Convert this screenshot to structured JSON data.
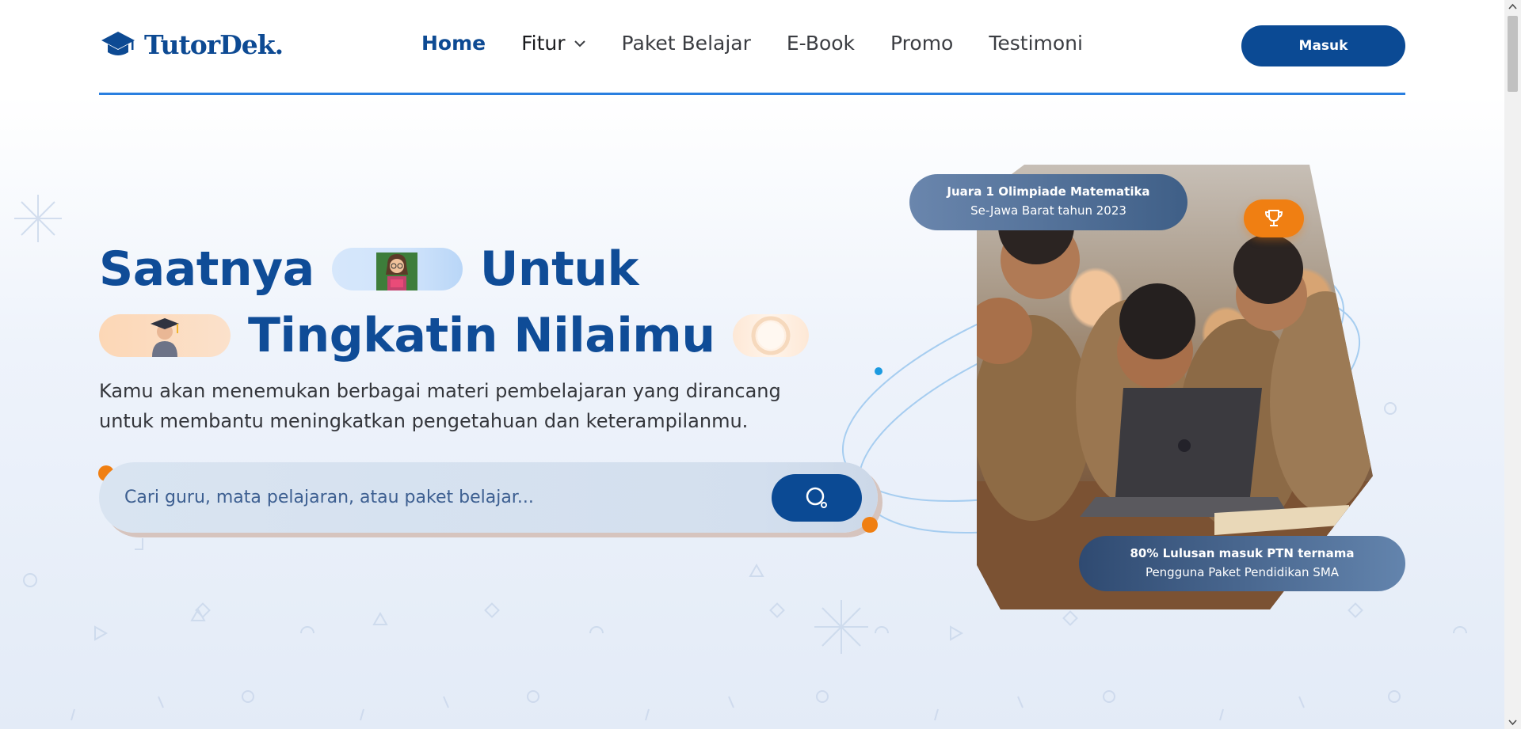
{
  "brand": {
    "name": "TutorDek.",
    "color": "#0d4a93"
  },
  "nav": {
    "items": [
      {
        "label": "Home",
        "state": "active"
      },
      {
        "label": "Fitur",
        "state": "dropdown"
      },
      {
        "label": "Paket Belajar"
      },
      {
        "label": "E-Book"
      },
      {
        "label": "Promo"
      },
      {
        "label": "Testimoni"
      }
    ],
    "login_label": "Masuk"
  },
  "hero": {
    "headline_line1_a": "Saatnya",
    "headline_line1_b": "Untuk",
    "headline_line2": "Tingkatin Nilaimu",
    "lead": "Kamu akan menemukan berbagai materi pembelajaran yang dirancang untuk membantu meningkatkan pengetahuan dan keterampilanmu.",
    "search_placeholder": "Cari guru, mata pelajaran, atau paket belajar...",
    "search_icon": "search-icon"
  },
  "badges": {
    "top": {
      "title": "Juara 1 Olimpiade Matematika",
      "sub": "Se-Jawa Barat tahun 2023"
    },
    "bottom": {
      "title": "80% Lulusan masuk PTN ternama",
      "sub": "Pengguna Paket Pendidikan SMA"
    },
    "trophy_icon": "trophy-icon"
  },
  "colors": {
    "primary": "#0b4a94",
    "accent": "#f07f12",
    "line": "#2a7fe0"
  }
}
